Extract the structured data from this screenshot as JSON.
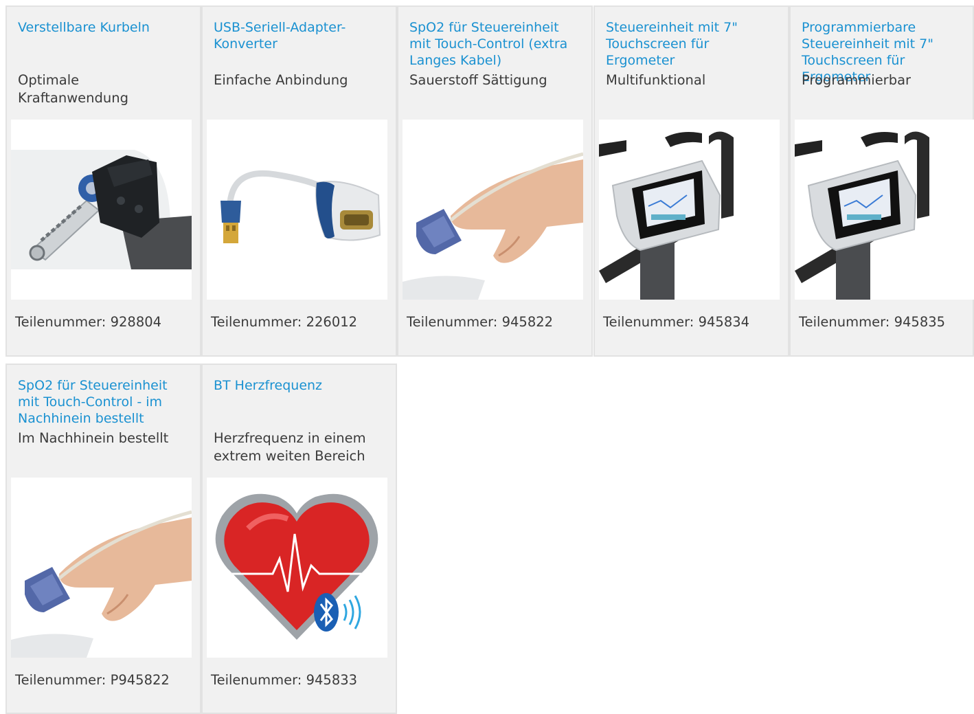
{
  "part_label": "Teilenummer:",
  "products": [
    {
      "title": "Verstellbare Kurbeln",
      "subtitle": "Optimale Kraftanwendung",
      "part_number": "928804",
      "image_icon": "crank-pedal-icon"
    },
    {
      "title": "USB-Seriell-Adapter-Konverter",
      "subtitle": "Einfache Anbindung",
      "part_number": "226012",
      "image_icon": "usb-serial-adapter-icon"
    },
    {
      "title": "SpO2 für Steuereinheit mit Touch-Control (extra Langes Kabel)",
      "subtitle": "Sauerstoff Sättigung",
      "part_number": "945822",
      "image_icon": "finger-sensor-icon"
    },
    {
      "title": "Steuereinheit mit 7\" Touchscreen für Ergometer",
      "subtitle": "Multifunktional",
      "part_number": "945834",
      "image_icon": "touchscreen-console-icon"
    },
    {
      "title": "Programmierbare Steuereinheit mit 7\" Touchscreen für Ergometer",
      "subtitle": "Programmierbar",
      "part_number": "945835",
      "image_icon": "touchscreen-console-icon"
    },
    {
      "title": "SpO2 für Steuereinheit mit Touch-Control - im Nachhinein bestellt",
      "subtitle": "Im Nachhinein bestellt",
      "part_number": "P945822",
      "image_icon": "finger-sensor-icon"
    },
    {
      "title": "BT Herzfrequenz",
      "subtitle": "Herzfrequenz in einem extrem weiten Bereich",
      "part_number": "945833",
      "image_icon": "bluetooth-heart-icon"
    }
  ]
}
